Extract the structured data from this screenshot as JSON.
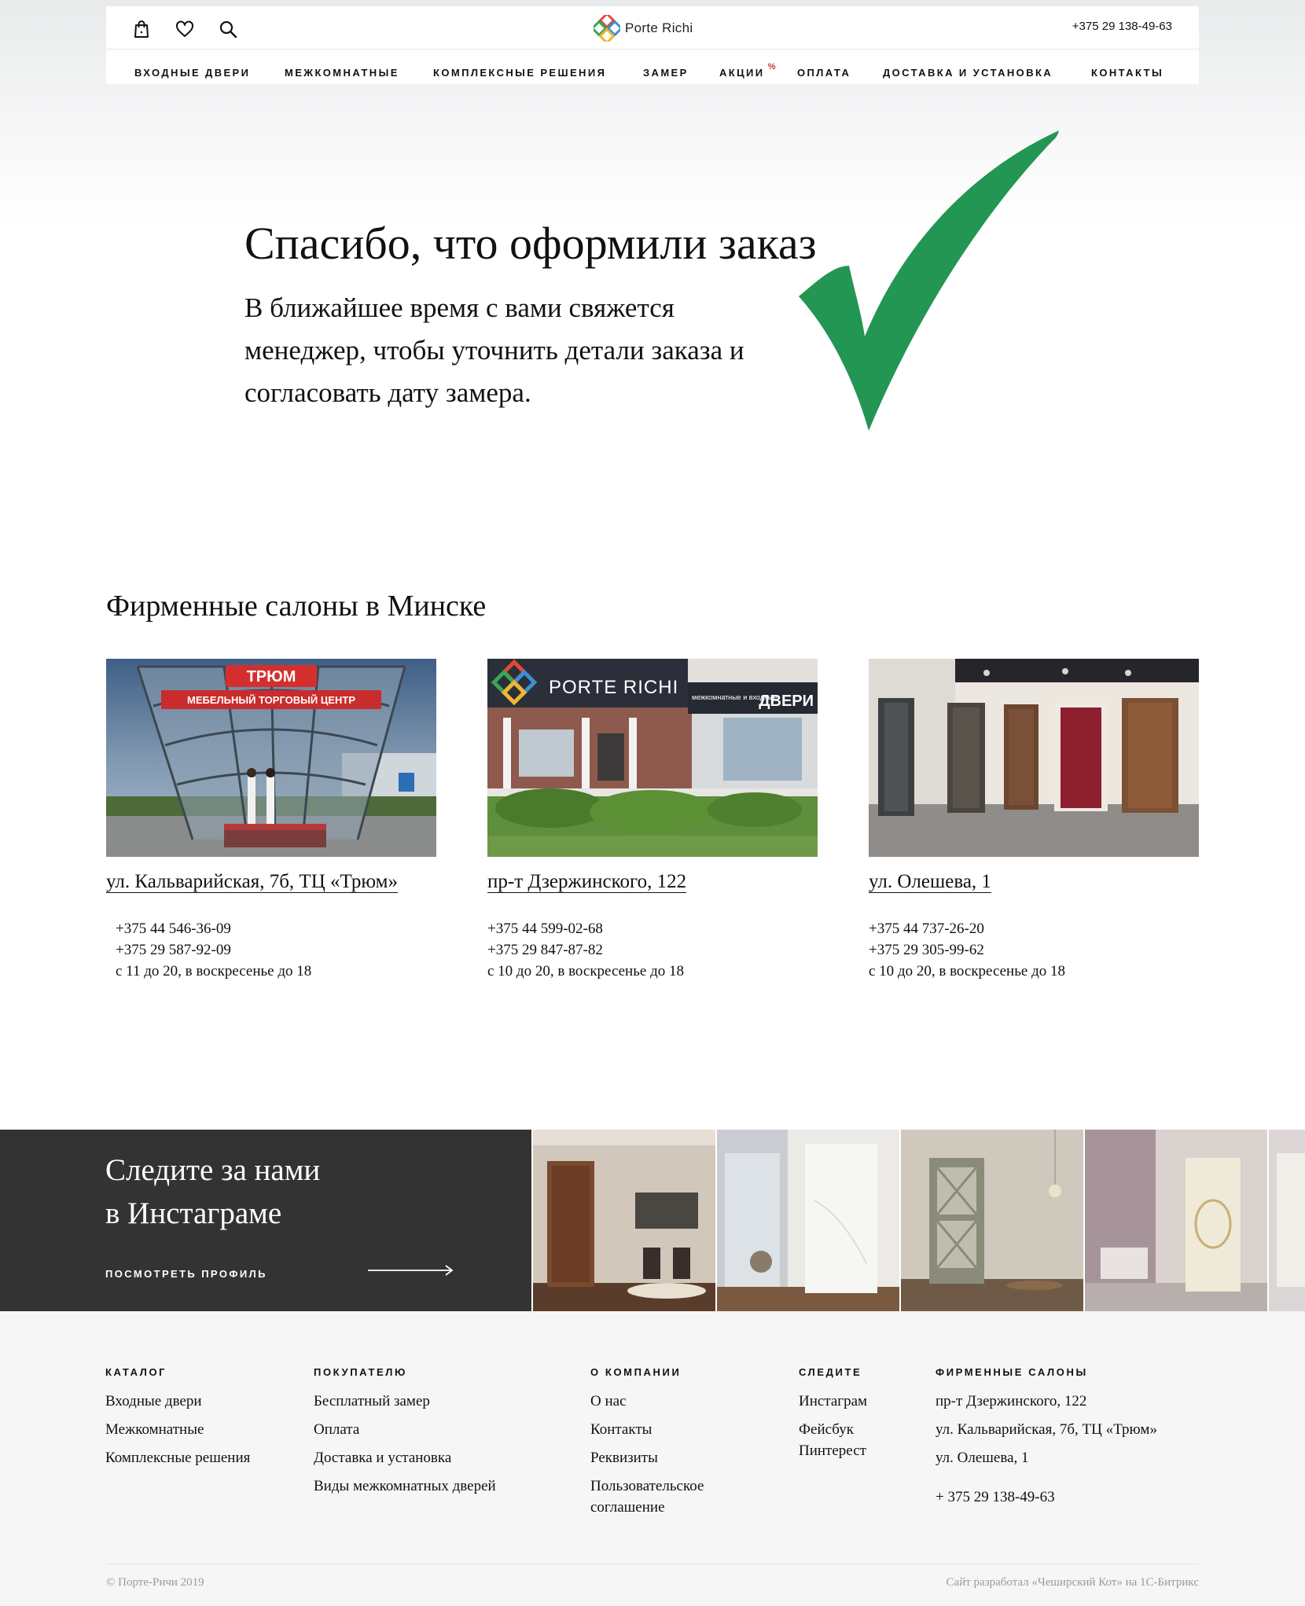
{
  "header": {
    "logo_text": "Porte Richi",
    "phone": "+375 29 138-49-63",
    "nav": [
      {
        "label": "ВХОДНЫЕ ДВЕРИ"
      },
      {
        "label": "МЕЖКОМНАТНЫЕ"
      },
      {
        "label": "КОМПЛЕКСНЫЕ РЕШЕНИЯ"
      },
      {
        "label": "ЗАМЕР"
      },
      {
        "label": "АКЦИИ",
        "badge": "%"
      },
      {
        "label": "ОПЛАТА"
      },
      {
        "label": "ДОСТАВКА И УСТАНОВКА"
      },
      {
        "label": "КОНТАКТЫ"
      }
    ],
    "icons": [
      "bag-icon",
      "heart-icon",
      "search-icon"
    ]
  },
  "thanks": {
    "title": "Спасибо, что оформили заказ",
    "text": "В ближайшее время с вами свяжется менеджер, чтобы уточнить детали заказа и согласовать дату замера.",
    "check_color": "#229652"
  },
  "salons": {
    "title": "Фирменные салоны в Минске",
    "items": [
      {
        "address": "ул. Кальварийская, 7б, ТЦ «Трюм»",
        "phone1": "+375 44 546-36-09",
        "phone2": "+375 29 587-92-09",
        "hours": "с 11 до 20, в воскресенье до 18",
        "sign_top": "ТРЮМ",
        "sign_bottom": "МЕБЕЛЬНЫЙ ТОРГОВЫЙ ЦЕНТР"
      },
      {
        "address": "пр-т Дзержинского, 122",
        "phone1": "+375 44 599-02-68",
        "phone2": "+375 29 847-87-82",
        "hours": "с 10 до 20, в воскресенье до 18",
        "sign_brand": "PORTE RICHI",
        "sign_small": "межкомнатные и входные",
        "sign_big": "ДВЕРИ"
      },
      {
        "address": "ул. Олешева, 1",
        "phone1": "+375 44 737-26-20",
        "phone2": "+375 29 305-99-62",
        "hours": "с 10 до 20, в воскресенье до 18"
      }
    ]
  },
  "instagram": {
    "title_line1": "Следите за нами",
    "title_line2": "в Инстаграме",
    "link_label": "ПОСМОТРЕТЬ ПРОФИЛЬ"
  },
  "footer": {
    "columns": [
      {
        "heading": "КАТАЛОГ",
        "links": [
          "Входные двери",
          "Межкомнатные",
          "Комплексные решения"
        ]
      },
      {
        "heading": "ПОКУПАТЕЛЮ",
        "links": [
          "Бесплатный замер",
          "Оплата",
          "Доставка и установка",
          "Виды межкомнатных дверей"
        ]
      },
      {
        "heading": "О КОМПАНИИ",
        "links": [
          "О нас",
          "Контакты",
          "Реквизиты",
          "Пользовательское соглашение"
        ]
      },
      {
        "heading": "СЛЕДИТЕ",
        "links": [
          "Инстаграм",
          "Фейсбук",
          "Пинтерест"
        ]
      },
      {
        "heading": "ФИРМЕННЫЕ САЛОНЫ",
        "links": [
          "пр-т Дзержинского, 122",
          "ул. Кальварийская, 7б, ТЦ «Трюм»",
          "ул. Олешева, 1"
        ],
        "phone": "+ 375 29 138-49-63"
      }
    ],
    "copyright": "© Порте-Ричи 2019",
    "developer": "Сайт разработал «Чеширский Кот» на 1С-Битрикс"
  }
}
